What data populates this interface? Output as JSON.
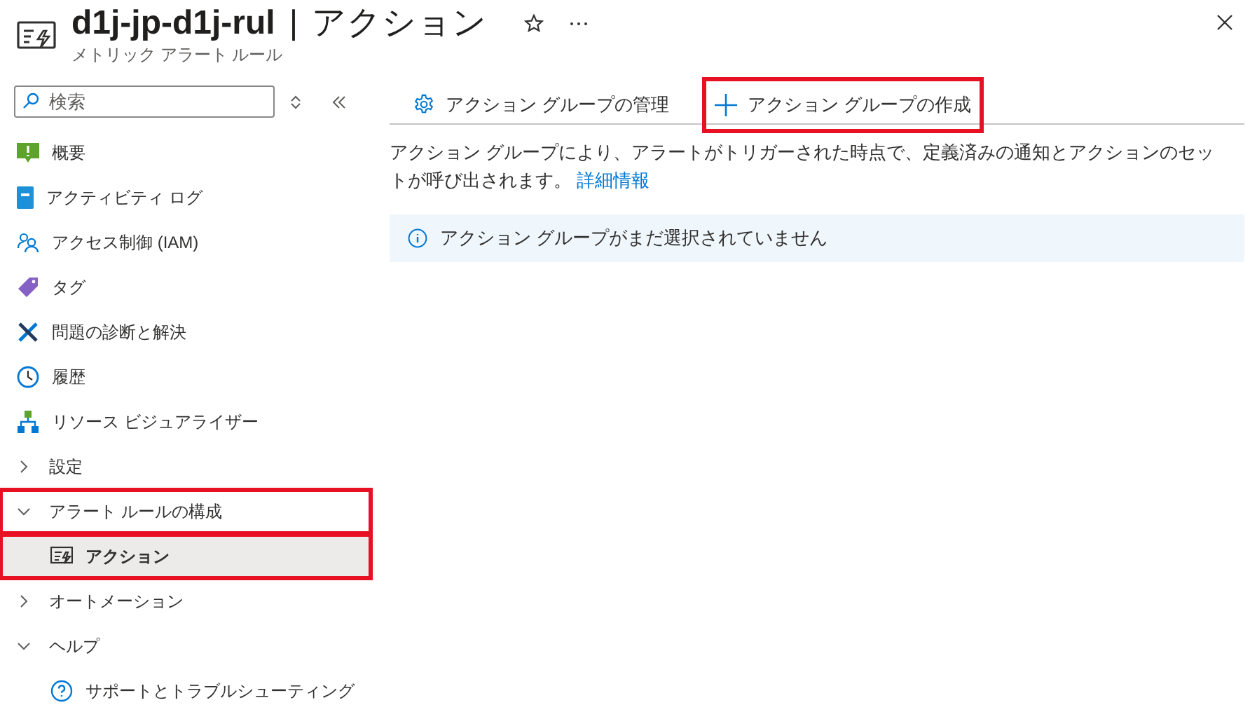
{
  "header": {
    "title": "d1j-jp-d1j-rul",
    "separator": "|",
    "page": "アクション",
    "subtitle": "メトリック アラート ルール"
  },
  "sidebar": {
    "search": {
      "placeholder": "検索"
    },
    "nav": [
      {
        "label": "概要",
        "selected": false,
        "highlighted": false
      },
      {
        "label": "アクティビティ ログ",
        "selected": false,
        "highlighted": false
      },
      {
        "label": "アクセス制御 (IAM)",
        "selected": false,
        "highlighted": false
      },
      {
        "label": "タグ",
        "selected": false,
        "highlighted": false
      },
      {
        "label": "問題の診断と解決",
        "selected": false,
        "highlighted": false
      },
      {
        "label": "履歴",
        "selected": false,
        "highlighted": false
      },
      {
        "label": "リソース ビジュアライザー",
        "selected": false,
        "highlighted": false
      },
      {
        "label": "設定",
        "expanded": false,
        "highlighted": false
      },
      {
        "label": "アラート ルールの構成",
        "expanded": true,
        "highlighted": true,
        "children": [
          {
            "label": "アクション",
            "selected": true,
            "highlighted": true
          }
        ]
      },
      {
        "label": "オートメーション",
        "expanded": false,
        "highlighted": false
      },
      {
        "label": "ヘルプ",
        "expanded": true,
        "highlighted": false,
        "children": [
          {
            "label": "サポートとトラブルシューティング",
            "selected": false,
            "highlighted": false
          }
        ]
      }
    ]
  },
  "toolbar": [
    {
      "label": "アクション グループの管理",
      "highlighted": false
    },
    {
      "label": "アクション グループの作成",
      "highlighted": true
    }
  ],
  "description": {
    "text": "アクション グループにより、アラートがトリガーされた時点で、定義済みの通知とアクションのセットが呼び出されます。",
    "link": "詳細情報"
  },
  "info": {
    "text": "アクション グループがまだ選択されていません"
  }
}
